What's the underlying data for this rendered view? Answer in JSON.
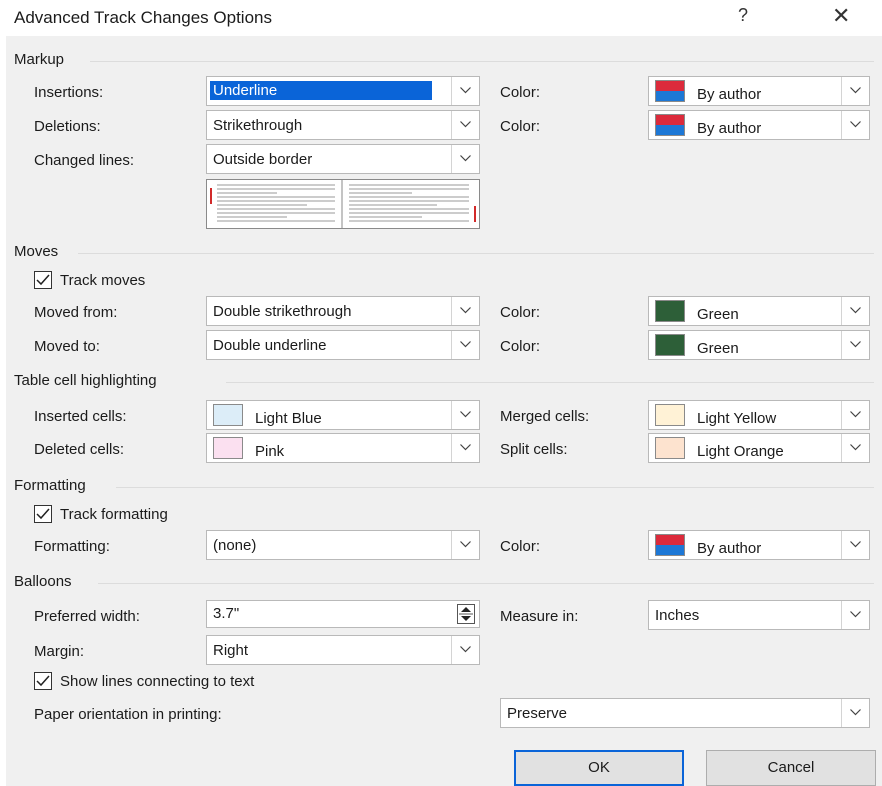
{
  "dialog": {
    "title": "Advanced Track Changes Options",
    "help_glyph": "?",
    "close_glyph": "✕"
  },
  "markup": {
    "heading": "Markup",
    "insertions_label": "Insertions:",
    "insertions_value": "Underline",
    "insertions_color_label": "Color:",
    "insertions_color_value": "By author",
    "deletions_label": "Deletions:",
    "deletions_value": "Strikethrough",
    "deletions_color_label": "Color:",
    "deletions_color_value": "By author",
    "changed_lines_label": "Changed lines:",
    "changed_lines_value": "Outside border"
  },
  "moves": {
    "heading": "Moves",
    "track_moves_label": "Track moves",
    "track_moves_checked": true,
    "moved_from_label": "Moved from:",
    "moved_from_value": "Double strikethrough",
    "moved_from_color_label": "Color:",
    "moved_from_color_value": "Green",
    "moved_to_label": "Moved to:",
    "moved_to_value": "Double underline",
    "moved_to_color_label": "Color:",
    "moved_to_color_value": "Green"
  },
  "table_cells": {
    "heading": "Table cell highlighting",
    "inserted_label": "Inserted cells:",
    "inserted_value": "Light Blue",
    "merged_label": "Merged cells:",
    "merged_value": "Light Yellow",
    "deleted_label": "Deleted cells:",
    "deleted_value": "Pink",
    "split_label": "Split cells:",
    "split_value": "Light Orange"
  },
  "formatting": {
    "heading": "Formatting",
    "track_formatting_label": "Track formatting",
    "track_formatting_checked": true,
    "formatting_label": "Formatting:",
    "formatting_value": "(none)",
    "color_label": "Color:",
    "color_value": "By author"
  },
  "balloons": {
    "heading": "Balloons",
    "preferred_width_label": "Preferred width:",
    "preferred_width_value": "3.7\"",
    "measure_in_label": "Measure in:",
    "measure_in_value": "Inches",
    "margin_label": "Margin:",
    "margin_value": "Right",
    "show_lines_label": "Show lines connecting to text",
    "show_lines_checked": true,
    "paper_orientation_label": "Paper orientation in printing:",
    "paper_orientation_value": "Preserve"
  },
  "buttons": {
    "ok": "OK",
    "cancel": "Cancel"
  },
  "colors": {
    "by_author_top": "#dc2b3c",
    "by_author_bottom": "#1d78d6",
    "green": "#2d5f38",
    "light_blue": "#dcedf8",
    "light_yellow": "#fff2d6",
    "pink": "#fbe0f0",
    "light_orange": "#fde3cf",
    "selection": "#0a64d8",
    "changed_line_marker": "#d22a2a"
  }
}
